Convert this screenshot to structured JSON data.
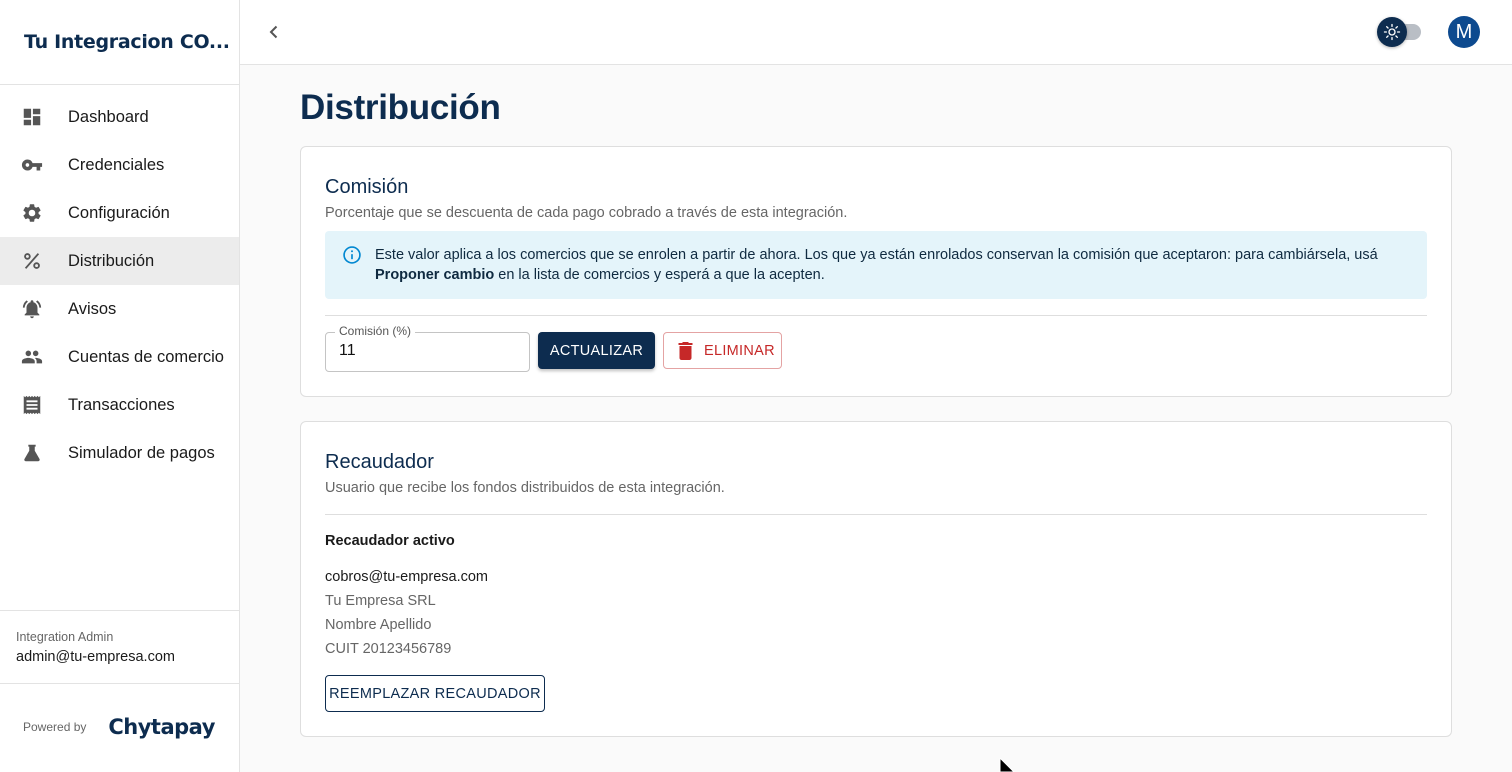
{
  "sidebar": {
    "brand": "Tu Integracion CO...",
    "items": [
      {
        "label": "Dashboard",
        "icon": "dashboard-icon"
      },
      {
        "label": "Credenciales",
        "icon": "key-icon"
      },
      {
        "label": "Configuración",
        "icon": "gear-icon"
      },
      {
        "label": "Distribución",
        "icon": "percent-icon",
        "active": true
      },
      {
        "label": "Avisos",
        "icon": "bell-icon"
      },
      {
        "label": "Cuentas de comercio",
        "icon": "people-icon"
      },
      {
        "label": "Transacciones",
        "icon": "receipt-icon"
      },
      {
        "label": "Simulador de pagos",
        "icon": "flask-icon"
      }
    ],
    "user_role": "Integration Admin",
    "user_email": "admin@tu-empresa.com",
    "powered_by": "Powered by",
    "powered_brand": "Chytapay"
  },
  "topbar": {
    "avatar_letter": "M",
    "theme": "light"
  },
  "page": {
    "title": "Distribución"
  },
  "comision": {
    "title": "Comisión",
    "subtitle": "Porcentaje que se descuenta de cada pago cobrado a través de esta integración.",
    "info_part1": "Este valor aplica a los comercios que se enrolen a partir de ahora. Los que ya están enrolados conservan la comisión que aceptaron: para cambiársela, usá ",
    "info_bold": "Proponer cambio",
    "info_part2": " en la lista de comercios y esperá a que la acepten.",
    "field_label": "Comisión (%)",
    "field_value": "11",
    "update_label": "ACTUALIZAR",
    "delete_label": "ELIMINAR"
  },
  "recaudador": {
    "title": "Recaudador",
    "subtitle": "Usuario que recibe los fondos distribuidos de esta integración.",
    "active_label": "Recaudador activo",
    "email": "cobros@tu-empresa.com",
    "company": "Tu Empresa SRL",
    "name": "Nombre Apellido",
    "cuit": "CUIT 20123456789",
    "replace_label": "REEMPLAZAR RECAUDADOR"
  },
  "colors": {
    "primary": "#0d2c4f",
    "danger": "#c62828",
    "info_bg": "#e4f4fa",
    "avatar": "#0d4a8f"
  }
}
